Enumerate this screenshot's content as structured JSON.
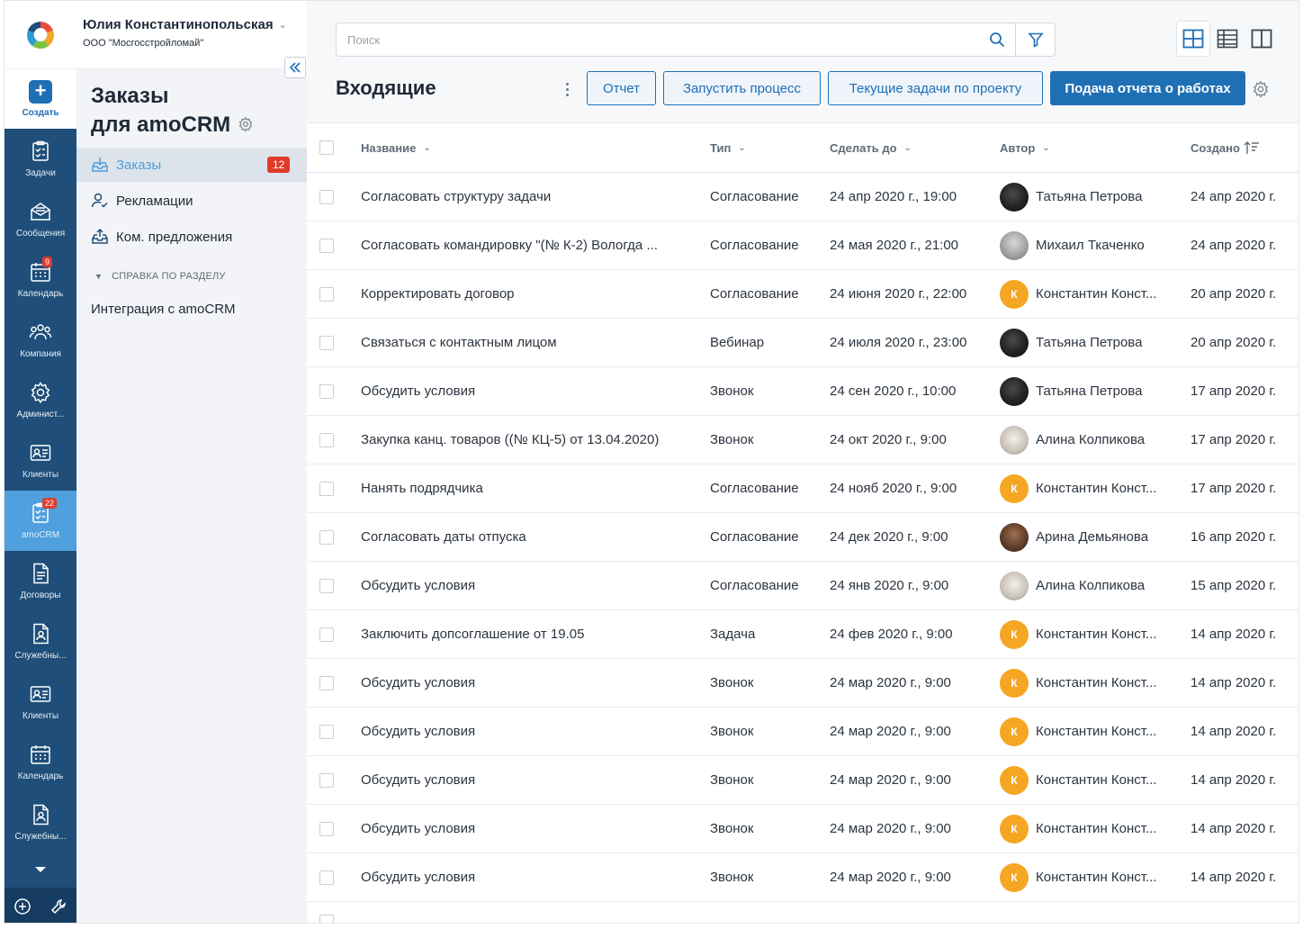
{
  "user": {
    "name": "Юлия Константинопольская",
    "org": "ООО \"Мосгосстройломай\""
  },
  "create": {
    "label": "Создать"
  },
  "rail": {
    "items": [
      {
        "label": "Задачи",
        "icon": "tasks-icon"
      },
      {
        "label": "Сообщения",
        "icon": "messages-icon"
      },
      {
        "label": "Календарь",
        "icon": "calendar-icon",
        "badge": "9"
      },
      {
        "label": "Компания",
        "icon": "company-icon"
      },
      {
        "label": "Админист...",
        "icon": "gear-icon"
      },
      {
        "label": "Клиенты",
        "icon": "clients-icon"
      },
      {
        "label": "amoCRM",
        "icon": "amocrm-icon",
        "badge": "22",
        "active": true
      },
      {
        "label": "Договоры",
        "icon": "contracts-icon"
      },
      {
        "label": "Служебны...",
        "icon": "service-icon"
      },
      {
        "label": "Клиенты",
        "icon": "clients-icon"
      },
      {
        "label": "Календарь",
        "icon": "calendar-icon"
      },
      {
        "label": "Служебны...",
        "icon": "service-icon"
      }
    ]
  },
  "sidebar": {
    "title_line1": "Заказы",
    "title_line2": "для amoCRM",
    "items": [
      {
        "label": "Заказы",
        "badge": "12",
        "active": true
      },
      {
        "label": "Рекламации"
      },
      {
        "label": "Ком. предложения"
      }
    ],
    "help_heading": "СПРАВКА ПО РАЗДЕЛУ",
    "help_link": "Интеграция с amoCRM"
  },
  "search": {
    "placeholder": "Поиск"
  },
  "page": {
    "title": "Входящие"
  },
  "toolbar": {
    "report": "Отчет",
    "start_process": "Запустить процесс",
    "current_tasks": "Текущие задачи по проекту",
    "submit_report": "Подача отчета о работах"
  },
  "colors": {
    "accent": "#1f6fb5",
    "rail": "#1e4e79",
    "rail_active": "#4fa0dc",
    "badge": "#e03b2a",
    "avatar_orange": "#f5a623"
  },
  "table": {
    "columns": {
      "name": "Название",
      "type": "Тип",
      "due": "Сделать до",
      "author": "Автор",
      "created": "Создано"
    },
    "rows": [
      {
        "name": "Согласовать структуру задачи",
        "type": "Согласование",
        "due": "24 апр 2020 г., 19:00",
        "author": "Татьяна Петрова",
        "av": "dark",
        "created": "24 апр 2020 г."
      },
      {
        "name": "Согласовать командировку \"(№ К-2) Вологда ...",
        "type": "Согласование",
        "due": "24 мая 2020 г., 21:00",
        "author": "Михаил Ткаченко",
        "av": "gray",
        "created": "24 апр 2020 г."
      },
      {
        "name": "Корректировать договор",
        "type": "Согласование",
        "due": "24 июня 2020 г., 22:00",
        "author": "Константин Конст...",
        "av": "orange",
        "initial": "К",
        "created": "20 апр 2020 г."
      },
      {
        "name": "Связаться с контактным лицом",
        "type": "Вебинар",
        "due": "24 июля 2020 г., 23:00",
        "author": "Татьяна Петрова",
        "av": "dark",
        "created": "20 апр 2020 г."
      },
      {
        "name": "Обсудить условия",
        "type": "Звонок",
        "due": "24 сен 2020 г., 10:00",
        "author": "Татьяна Петрова",
        "av": "dark",
        "created": "17 апр 2020 г."
      },
      {
        "name": "Закупка канц. товаров ((№ КЦ-5) от 13.04.2020)",
        "type": "Звонок",
        "due": "24 окт 2020 г., 9:00",
        "author": "Алина Колпикова",
        "av": "light",
        "created": "17 апр 2020 г."
      },
      {
        "name": "Нанять подрядчика",
        "type": "Согласование",
        "due": "24 нояб 2020 г., 9:00",
        "author": "Константин Конст...",
        "av": "orange",
        "initial": "К",
        "created": "17 апр 2020 г."
      },
      {
        "name": "Согласовать даты отпуска",
        "type": "Согласование",
        "due": "24 дек 2020 г., 9:00",
        "author": "Арина Демьянова",
        "av": "brown",
        "created": "16 апр 2020 г."
      },
      {
        "name": "Обсудить условия",
        "type": "Согласование",
        "due": "24 янв 2020 г., 9:00",
        "author": "Алина Колпикова",
        "av": "light",
        "created": "15 апр 2020 г."
      },
      {
        "name": "Заключить допсоглашение от 19.05",
        "type": "Задача",
        "due": "24 фев 2020 г., 9:00",
        "author": "Константин Конст...",
        "av": "orange",
        "initial": "К",
        "created": "14 апр 2020 г."
      },
      {
        "name": "Обсудить условия",
        "type": "Звонок",
        "due": "24 мар 2020 г., 9:00",
        "author": "Константин Конст...",
        "av": "orange",
        "initial": "К",
        "created": "14 апр 2020 г."
      },
      {
        "name": "Обсудить условия",
        "type": "Звонок",
        "due": "24 мар 2020 г., 9:00",
        "author": "Константин Конст...",
        "av": "orange",
        "initial": "К",
        "created": "14 апр 2020 г."
      },
      {
        "name": "Обсудить условия",
        "type": "Звонок",
        "due": "24 мар 2020 г., 9:00",
        "author": "Константин Конст...",
        "av": "orange",
        "initial": "К",
        "created": "14 апр 2020 г."
      },
      {
        "name": "Обсудить условия",
        "type": "Звонок",
        "due": "24 мар 2020 г., 9:00",
        "author": "Константин Конст...",
        "av": "orange",
        "initial": "К",
        "created": "14 апр 2020 г."
      },
      {
        "name": "Обсудить условия",
        "type": "Звонок",
        "due": "24 мар 2020 г., 9:00",
        "author": "Константин Конст...",
        "av": "orange",
        "initial": "К",
        "created": "14 апр 2020 г."
      }
    ]
  }
}
